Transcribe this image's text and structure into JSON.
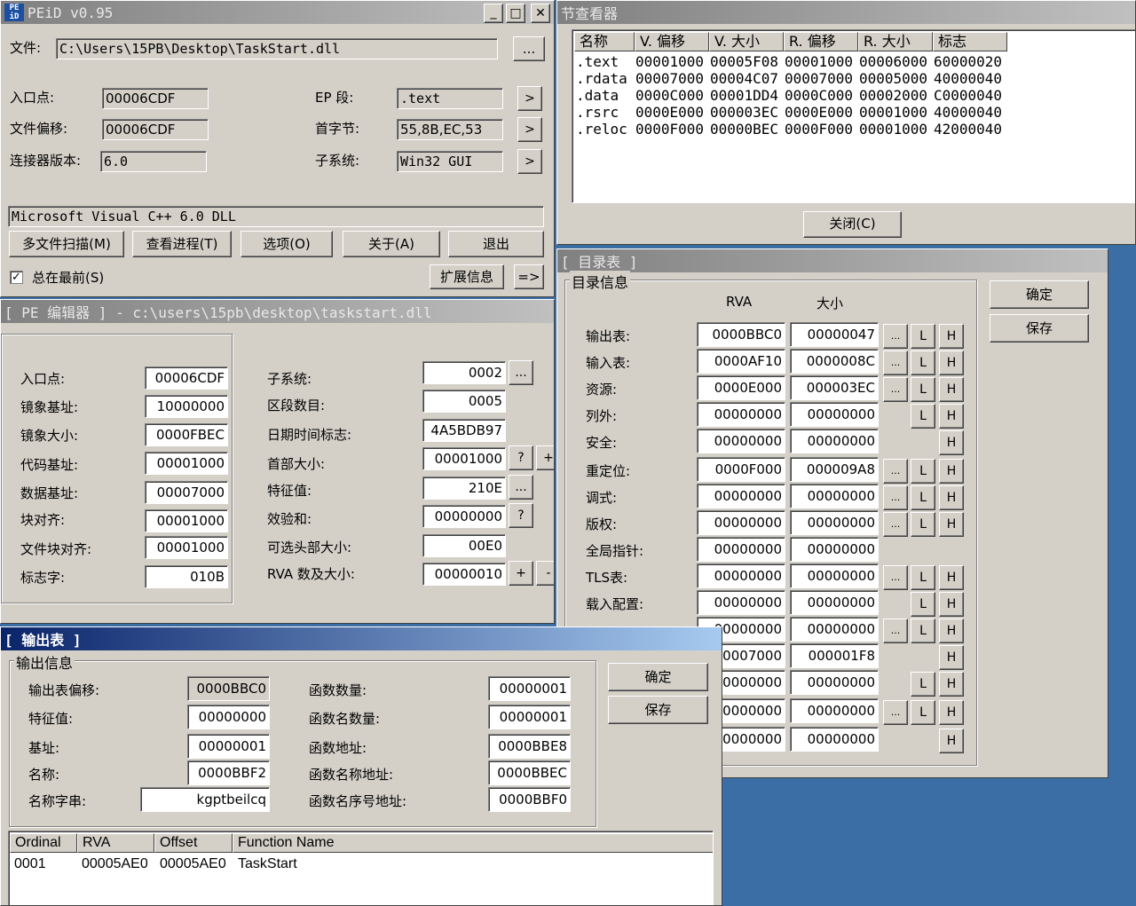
{
  "peid": {
    "title": "PEiD v0.95",
    "win_buttons": [
      "_",
      "□",
      "✕"
    ],
    "file_label": "文件:",
    "file_path": "C:\\Users\\15PB\\Desktop\\TaskStart.dll",
    "browse": "...",
    "entry_label": "入口点:",
    "entry_value": "00006CDF",
    "ep_label": "EP 段:",
    "ep_value": ".text",
    "offset_label": "文件偏移:",
    "offset_value": "00006CDF",
    "firstbyte_label": "首字节:",
    "firstbyte_value": "55,8B,EC,53",
    "linker_label": "连接器版本:",
    "linker_value": "6.0",
    "subsys_label": "子系统:",
    "subsys_value": "Win32 GUI",
    "arrow": ">",
    "detect": "Microsoft Visual C++ 6.0 DLL",
    "buttons": [
      "多文件扫描(M)",
      "查看进程(T)",
      "选项(O)",
      "关于(A)",
      "退出"
    ],
    "ontop_label": "总在最前(S)",
    "ontop_check": "✓",
    "ext_info": "扩展信息",
    "more": "=>"
  },
  "section_viewer": {
    "title": "节查看器",
    "headers": [
      "名称",
      "V. 偏移",
      "V. 大小",
      "R. 偏移",
      "R. 大小",
      "标志"
    ],
    "rows": [
      [
        ".text",
        "00001000",
        "00005F08",
        "00001000",
        "00006000",
        "60000020"
      ],
      [
        ".rdata",
        "00007000",
        "00004C07",
        "00007000",
        "00005000",
        "40000040"
      ],
      [
        ".data",
        "0000C000",
        "00001DD4",
        "0000C000",
        "00002000",
        "C0000040"
      ],
      [
        ".rsrc",
        "0000E000",
        "000003EC",
        "0000E000",
        "00001000",
        "40000040"
      ],
      [
        ".reloc",
        "0000F000",
        "00000BEC",
        "0000F000",
        "00001000",
        "42000040"
      ]
    ],
    "close": "关闭(C)"
  },
  "pe_editor": {
    "title": "[ PE 编辑器 ] - c:\\users\\15pb\\desktop\\taskstart.dll",
    "left": [
      {
        "label": "入口点:",
        "value": "00006CDF"
      },
      {
        "label": "镜象基址:",
        "value": "10000000"
      },
      {
        "label": "镜象大小:",
        "value": "0000FBEC"
      },
      {
        "label": "代码基址:",
        "value": "00001000"
      },
      {
        "label": "数据基址:",
        "value": "00007000"
      },
      {
        "label": "块对齐:",
        "value": "00001000"
      },
      {
        "label": "文件块对齐:",
        "value": "00001000"
      },
      {
        "label": "标志字:",
        "value": "010B"
      }
    ],
    "right": [
      {
        "label": "子系统:",
        "value": "0002"
      },
      {
        "label": "区段数目:",
        "value": "0005"
      },
      {
        "label": "日期时间标志:",
        "value": "4A5BDB97"
      },
      {
        "label": "首部大小:",
        "value": "00001000"
      },
      {
        "label": "特征值:",
        "value": "210E"
      },
      {
        "label": "效验和:",
        "value": "00000000"
      },
      {
        "label": "可选头部大小:",
        "value": "00E0"
      },
      {
        "label": "RVA 数及大小:",
        "value": "00000010"
      }
    ],
    "dots": "...",
    "q": "?",
    "plus": "+",
    "minus": "-"
  },
  "directory": {
    "title": "[ 目录表 ]",
    "group": "目录信息",
    "col_rva": "RVA",
    "col_size": "大小",
    "ok": "确定",
    "save": "保存",
    "rows": [
      {
        "label": "输出表:",
        "rva": "0000BBC0",
        "size": "00000047"
      },
      {
        "label": "输入表:",
        "rva": "0000AF10",
        "size": "0000008C"
      },
      {
        "label": "资源:",
        "rva": "0000E000",
        "size": "000003EC"
      },
      {
        "label": "列外:",
        "rva": "00000000",
        "size": "00000000"
      },
      {
        "label": "安全:",
        "rva": "00000000",
        "size": "00000000"
      },
      {
        "label": "重定位:",
        "rva": "0000F000",
        "size": "000009A8"
      },
      {
        "label": "调式:",
        "rva": "00000000",
        "size": "00000000"
      },
      {
        "label": "版权:",
        "rva": "00000000",
        "size": "00000000"
      },
      {
        "label": "全局指针:",
        "rva": "00000000",
        "size": "00000000"
      },
      {
        "label": "TLS表:",
        "rva": "00000000",
        "size": "00000000"
      },
      {
        "label": "载入配置:",
        "rva": "00000000",
        "size": "00000000"
      },
      {
        "label": "",
        "rva": "00000000",
        "size": "00000000"
      },
      {
        "label": "",
        "rva": "00007000",
        "size": "000001F8"
      },
      {
        "label": "",
        "rva": "00000000",
        "size": "00000000"
      },
      {
        "label": "",
        "rva": "00000000",
        "size": "00000000"
      },
      {
        "label": "",
        "rva": "00000000",
        "size": "00000000"
      }
    ],
    "dots": "...",
    "L": "L",
    "H": "H"
  },
  "export": {
    "title": "[ 输出表 ]",
    "group": "输出信息",
    "ok": "确定",
    "save": "保存",
    "left": [
      {
        "label": "输出表偏移:",
        "value": "0000BBC0"
      },
      {
        "label": "特征值:",
        "value": "00000000"
      },
      {
        "label": "基址:",
        "value": "00000001"
      },
      {
        "label": "名称:",
        "value": "0000BBF2"
      },
      {
        "label": "名称字串:",
        "value": "kgptbeilcq"
      }
    ],
    "right": [
      {
        "label": "函数数量:",
        "value": "00000001"
      },
      {
        "label": "函数名数量:",
        "value": "00000001"
      },
      {
        "label": "函数地址:",
        "value": "0000BBE8"
      },
      {
        "label": "函数名称地址:",
        "value": "0000BBEC"
      },
      {
        "label": "函数名序号地址:",
        "value": "0000BBF0"
      }
    ],
    "headers": [
      "Ordinal",
      "RVA",
      "Offset",
      "Function Name"
    ],
    "rows": [
      [
        "0001",
        "00005AE0",
        "00005AE0",
        "TaskStart"
      ]
    ]
  }
}
